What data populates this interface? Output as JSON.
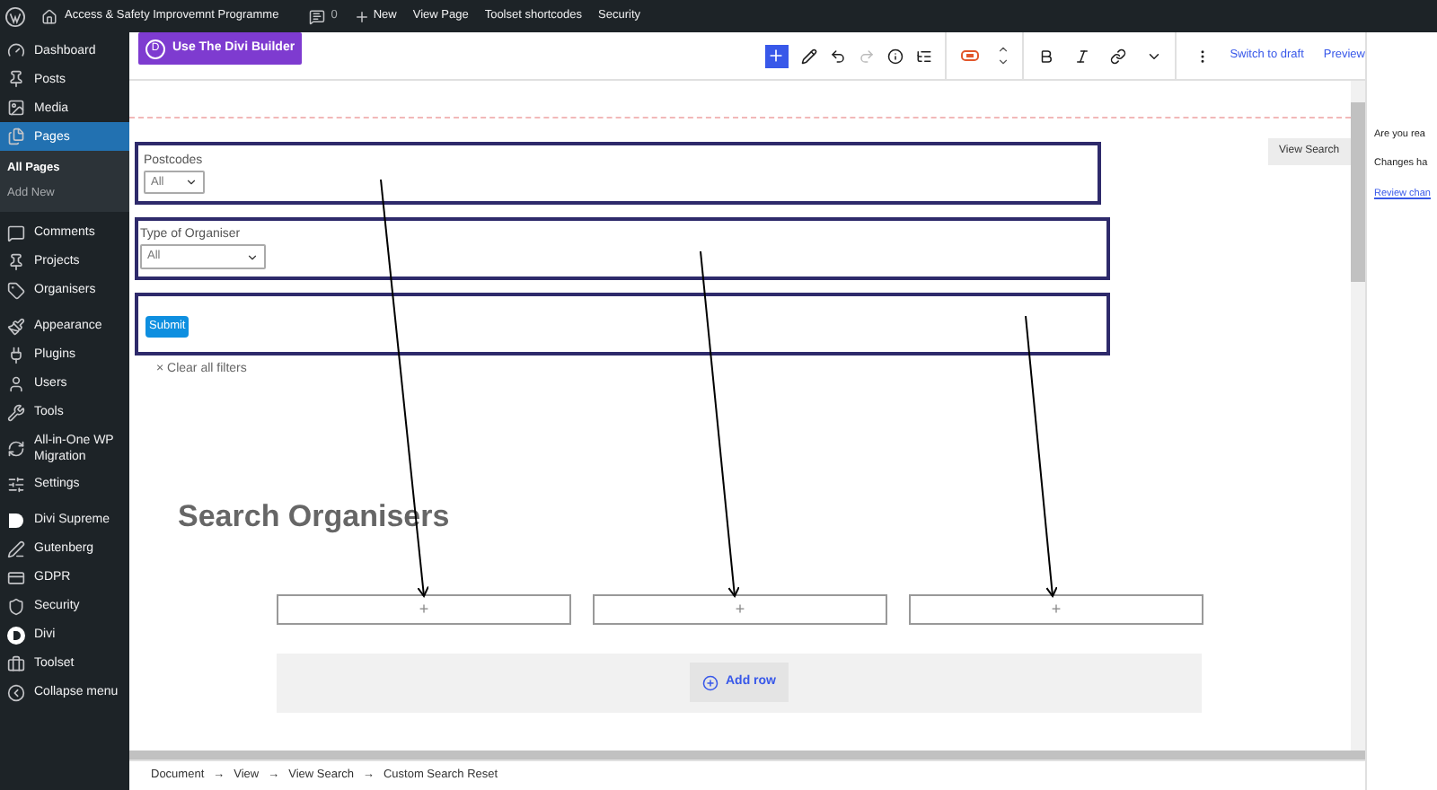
{
  "admin_bar": {
    "site_title": "Access & Safety Improvemnt Programme",
    "comments_count": "0",
    "items": [
      "New",
      "View Page",
      "Toolset shortcodes",
      "Security"
    ]
  },
  "sidebar": {
    "items": [
      {
        "label": "Dashboard",
        "selected": false
      },
      {
        "label": "Posts",
        "selected": false
      },
      {
        "label": "Media",
        "selected": false
      },
      {
        "label": "Pages",
        "selected": true,
        "children": [
          {
            "label": "All Pages",
            "selected": true
          },
          {
            "label": "Add New",
            "selected": false
          }
        ]
      },
      {
        "label": "Comments",
        "selected": false
      },
      {
        "label": "Projects",
        "selected": false
      },
      {
        "label": "Organisers",
        "selected": false
      },
      {
        "label": "Appearance",
        "selected": false
      },
      {
        "label": "Plugins",
        "selected": false
      },
      {
        "label": "Users",
        "selected": false
      },
      {
        "label": "Tools",
        "selected": false
      },
      {
        "label": "All-in-One WP Migration",
        "selected": false
      },
      {
        "label": "Settings",
        "selected": false
      },
      {
        "label": "Divi Supreme",
        "selected": false
      },
      {
        "label": "Gutenberg",
        "selected": false
      },
      {
        "label": "GDPR",
        "selected": false
      },
      {
        "label": "Security",
        "selected": false
      },
      {
        "label": "Divi",
        "selected": false
      },
      {
        "label": "Toolset",
        "selected": false
      },
      {
        "label": "Collapse menu",
        "selected": false
      }
    ]
  },
  "toolbar": {
    "divi_button": "Use The Divi Builder",
    "divi_logo": "D",
    "switch_to_draft": "Switch to draft",
    "preview": "Preview"
  },
  "form": {
    "fields": [
      {
        "label": "Postcodes",
        "value": "All"
      },
      {
        "label": "Type of Organiser",
        "value": "All"
      }
    ],
    "submit": "Submit",
    "clear": "× Clear all filters",
    "view_search": "View Search"
  },
  "heading": "Search Organisers",
  "columns": [
    {
      "add": "+"
    },
    {
      "add": "+"
    },
    {
      "add": "+"
    }
  ],
  "add_row": "Add row",
  "breadcrumb": [
    "Document",
    "View",
    "View Search",
    "Custom Search Reset"
  ],
  "breadcrumb_separator": "→",
  "side_panel": {
    "lines": [
      "Are you rea",
      "Changes ha"
    ],
    "link": "Review chan"
  }
}
